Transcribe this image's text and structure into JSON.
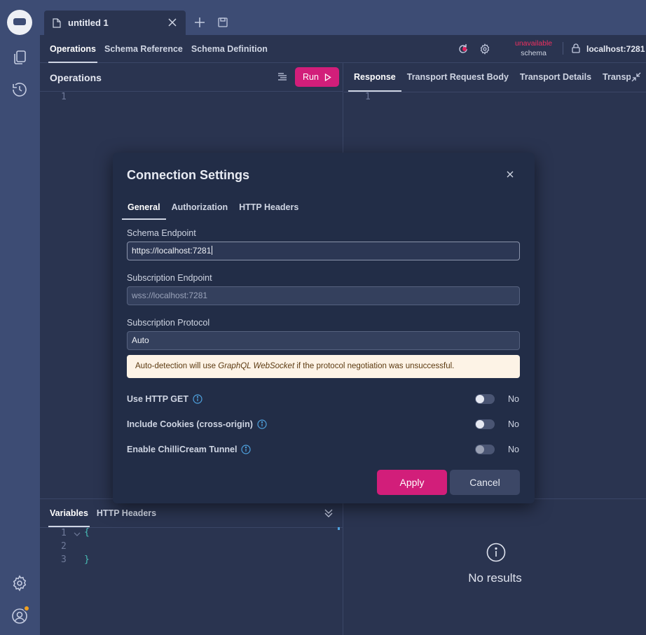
{
  "tabs": {
    "document_title": "untitled 1"
  },
  "toolbar": {
    "nav": [
      "Operations",
      "Schema Reference",
      "Schema Definition"
    ],
    "status_main": "unavailable",
    "status_sub": "schema",
    "host": "localhost:7281"
  },
  "operations": {
    "title": "Operations",
    "run_label": "Run",
    "line_numbers": [
      "1"
    ]
  },
  "response": {
    "tabs": [
      "Response",
      "Transport Request Body",
      "Transport Details",
      "Transpor"
    ],
    "line_numbers": [
      "1"
    ],
    "no_results": "No results"
  },
  "variables": {
    "tabs": [
      "Variables",
      "HTTP Headers"
    ],
    "line_numbers": [
      "1",
      "2",
      "3"
    ],
    "code": [
      "{",
      "",
      "}"
    ]
  },
  "modal": {
    "title": "Connection Settings",
    "tabs": [
      "General",
      "Authorization",
      "HTTP Headers"
    ],
    "schema_endpoint_label": "Schema Endpoint",
    "schema_endpoint_value": "https://localhost:7281",
    "subscription_endpoint_label": "Subscription Endpoint",
    "subscription_endpoint_placeholder": "wss://localhost:7281",
    "subscription_protocol_label": "Subscription Protocol",
    "subscription_protocol_value": "Auto",
    "note_pre": "Auto-detection will use ",
    "note_em": "GraphQL WebSocket",
    "note_post": " if the protocol negotiation was unsuccessful.",
    "options": [
      {
        "label": "Use HTTP GET",
        "value": "No"
      },
      {
        "label": "Include Cookies (cross-origin)",
        "value": "No"
      },
      {
        "label": "Enable ChilliCream Tunnel",
        "value": "No"
      }
    ],
    "apply_label": "Apply",
    "cancel_label": "Cancel"
  },
  "colors": {
    "accent": "#d21e7a",
    "status_error": "#f03060",
    "info": "#4fa3e0"
  }
}
